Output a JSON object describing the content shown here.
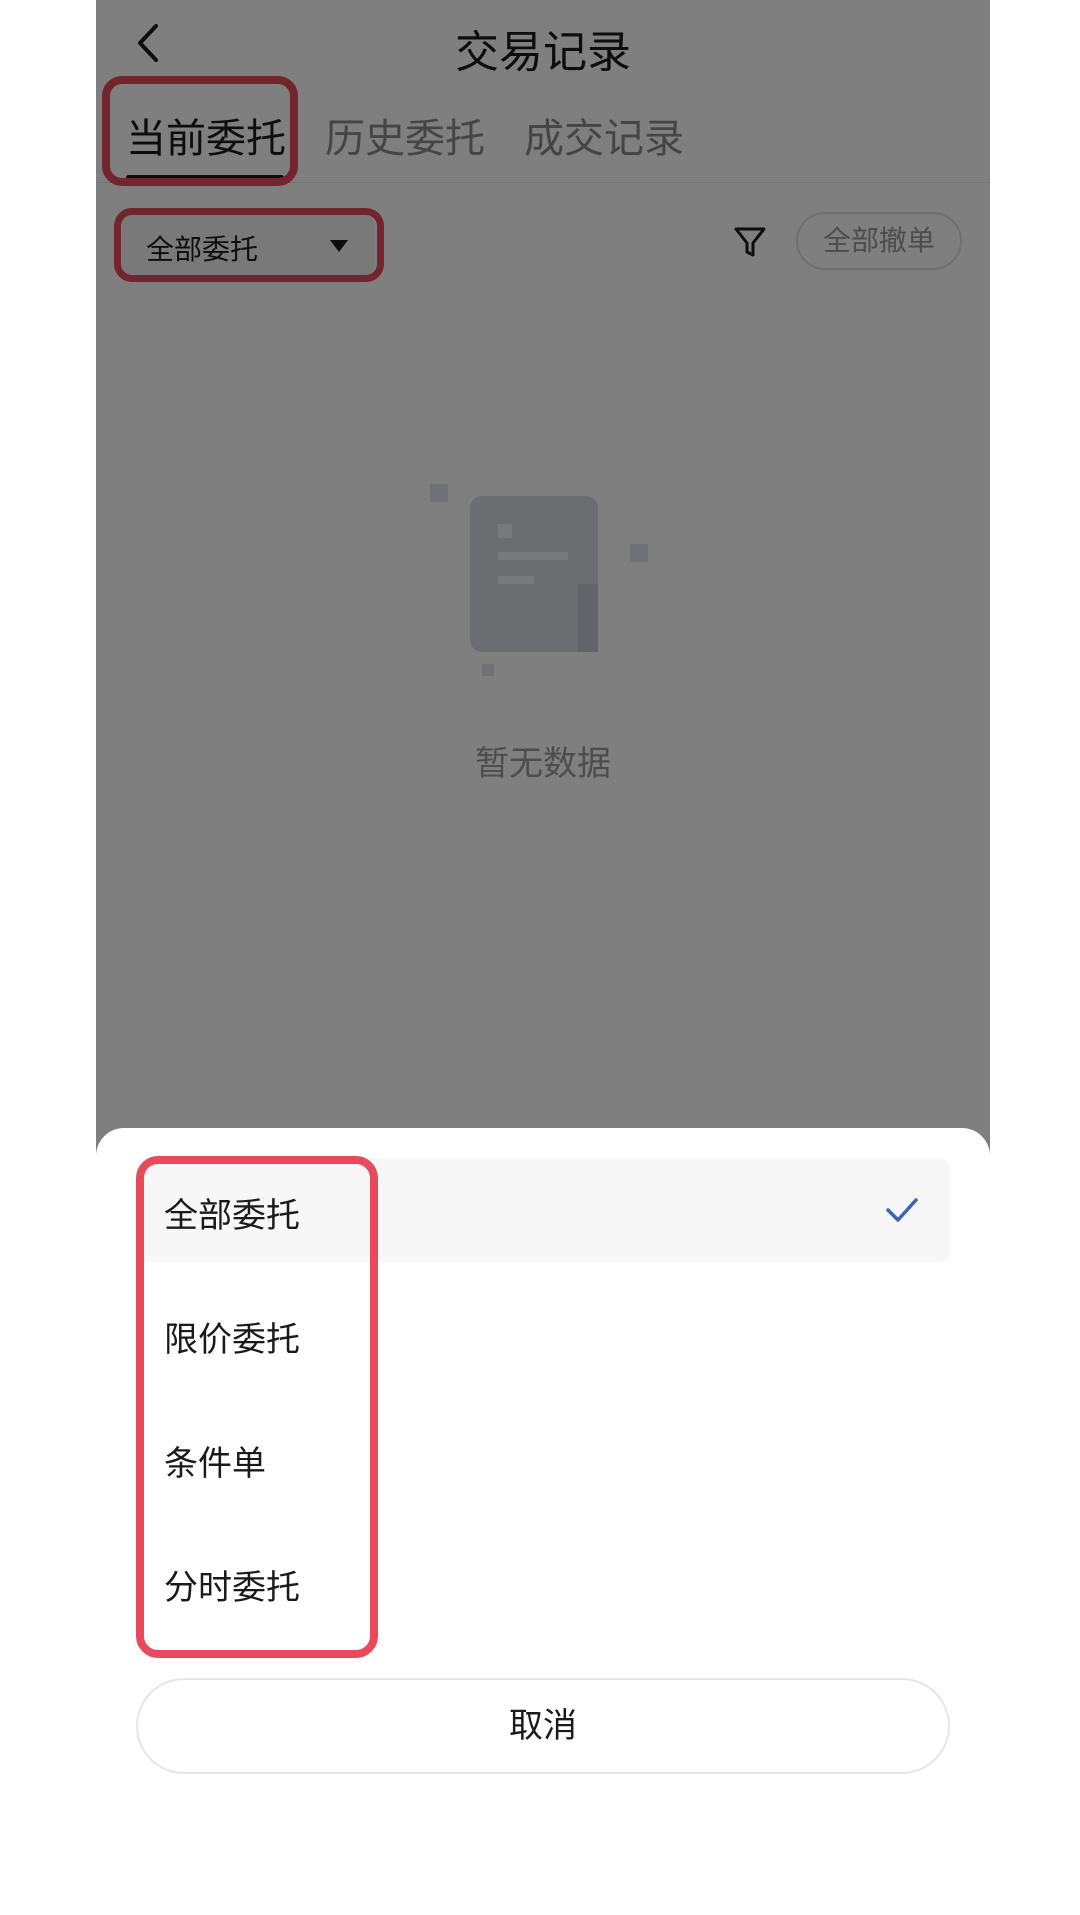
{
  "header": {
    "title": "交易记录",
    "back_icon": "chevron-left-icon"
  },
  "tabs": [
    {
      "label": "当前委托",
      "active": true
    },
    {
      "label": "历史委托",
      "active": false
    },
    {
      "label": "成交记录",
      "active": false
    }
  ],
  "toolbar": {
    "dropdown_value": "全部委托",
    "filter_icon": "filter-icon",
    "cancel_all_label": "全部撤单"
  },
  "empty_state": {
    "text": "暂无数据",
    "icon": "empty-document-icon"
  },
  "sheet": {
    "options": [
      {
        "label": "全部委托",
        "selected": true
      },
      {
        "label": "限价委托",
        "selected": false
      },
      {
        "label": "条件单",
        "selected": false
      },
      {
        "label": "分时委托",
        "selected": false
      }
    ],
    "cancel_label": "取消",
    "check_icon": "check-icon"
  },
  "colors": {
    "highlight": "#e64a5c",
    "check": "#3a64b4",
    "overlay": "rgba(0,0,0,0.5)"
  }
}
